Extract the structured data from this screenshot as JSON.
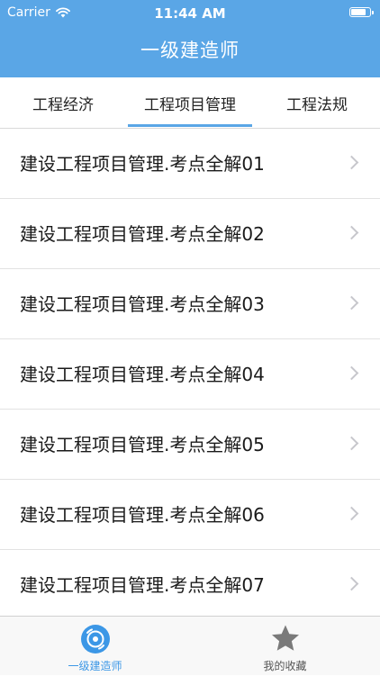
{
  "status_bar": {
    "carrier": "Carrier",
    "time": "11:44 AM",
    "battery_level": 0.85
  },
  "nav": {
    "title": "一级建造师"
  },
  "tabs": [
    {
      "label": "工程经济",
      "selected": false
    },
    {
      "label": "工程项目管理",
      "selected": true
    },
    {
      "label": "工程法规",
      "selected": false
    }
  ],
  "list": {
    "items": [
      {
        "label": "建设工程项目管理.考点全解01"
      },
      {
        "label": "建设工程项目管理.考点全解02"
      },
      {
        "label": "建设工程项目管理.考点全解03"
      },
      {
        "label": "建设工程项目管理.考点全解04"
      },
      {
        "label": "建设工程项目管理.考点全解05"
      },
      {
        "label": "建设工程项目管理.考点全解06"
      },
      {
        "label": "建设工程项目管理.考点全解07"
      }
    ]
  },
  "tabbar": {
    "items": [
      {
        "label": "一级建造师",
        "icon": "disc-icon",
        "selected": true
      },
      {
        "label": "我的收藏",
        "icon": "star-icon",
        "selected": false
      }
    ]
  },
  "colors": {
    "accent": "#5aa6e6",
    "tabbar_selected": "#3c97e6",
    "tabbar_unselected": "#7a7a7a"
  }
}
